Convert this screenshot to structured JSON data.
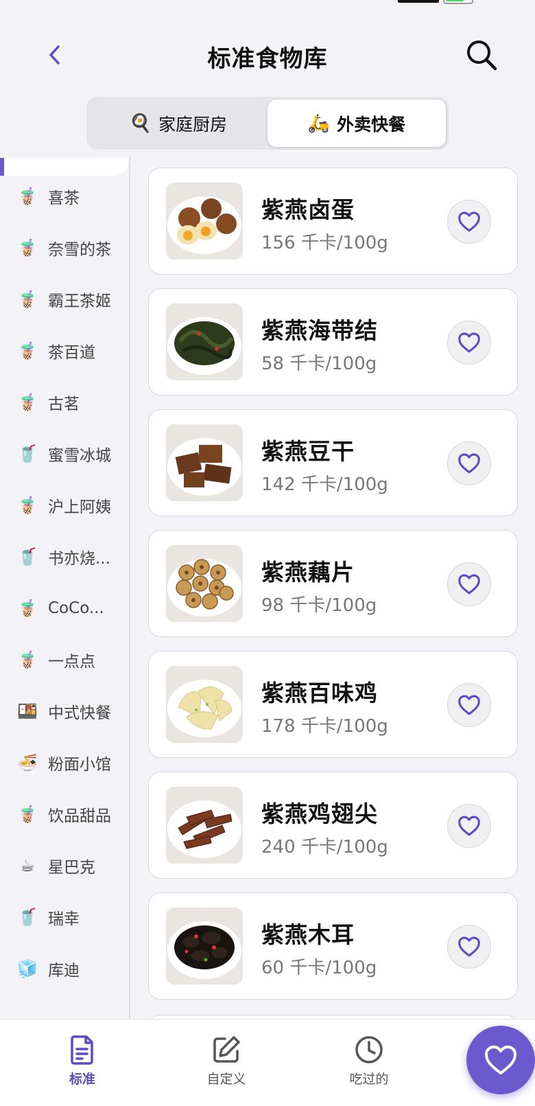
{
  "header": {
    "title": "标准食物库"
  },
  "segment": {
    "tabs": [
      {
        "icon": "🍳",
        "label": "家庭厨房",
        "active": false
      },
      {
        "icon": "🛵",
        "label": "外卖快餐",
        "active": true
      }
    ]
  },
  "sidebar": {
    "items": [
      {
        "icon": "bubble-tea-icon",
        "glyph": "🧋",
        "label": "喜茶"
      },
      {
        "icon": "bubble-tea-icon",
        "glyph": "🧋",
        "label": "奈雪的茶"
      },
      {
        "icon": "bubble-tea-icon",
        "glyph": "🧋",
        "label": "霸王茶姬"
      },
      {
        "icon": "bubble-tea-icon",
        "glyph": "🧋",
        "label": "茶百道"
      },
      {
        "icon": "bubble-tea-icon",
        "glyph": "🧋",
        "label": "古茗"
      },
      {
        "icon": "cup-straw-icon",
        "glyph": "🥤",
        "label": "蜜雪冰城"
      },
      {
        "icon": "bubble-tea-icon",
        "glyph": "🧋",
        "label": "沪上阿姨"
      },
      {
        "icon": "cup-straw-icon",
        "glyph": "🥤",
        "label": "书亦烧..."
      },
      {
        "icon": "bubble-tea-icon",
        "glyph": "🧋",
        "label": "CoCo..."
      },
      {
        "icon": "bubble-tea-icon",
        "glyph": "🧋",
        "label": "一点点"
      },
      {
        "icon": "bento-icon",
        "glyph": "🍱",
        "label": "中式快餐"
      },
      {
        "icon": "noodle-bowl-icon",
        "glyph": "🍜",
        "label": "粉面小馆"
      },
      {
        "icon": "bubble-tea-icon",
        "glyph": "🧋",
        "label": "饮品甜品"
      },
      {
        "icon": "coffee-icon",
        "glyph": "☕",
        "label": "星巴克"
      },
      {
        "icon": "cup-straw-icon",
        "glyph": "🥤",
        "label": "瑞幸"
      },
      {
        "icon": "ice-cube-icon",
        "glyph": "🧊",
        "label": "库迪"
      }
    ]
  },
  "foods": [
    {
      "name": "紫燕卤蛋",
      "kcal": "156 千卡/100g",
      "image": "braised-eggs"
    },
    {
      "name": "紫燕海带结",
      "kcal": "58 千卡/100g",
      "image": "kelp-knots"
    },
    {
      "name": "紫燕豆干",
      "kcal": "142 千卡/100g",
      "image": "dried-tofu"
    },
    {
      "name": "紫燕藕片",
      "kcal": "98 千卡/100g",
      "image": "lotus-root-slices"
    },
    {
      "name": "紫燕百味鸡",
      "kcal": "178 千卡/100g",
      "image": "sliced-chicken"
    },
    {
      "name": "紫燕鸡翅尖",
      "kcal": "240 千卡/100g",
      "image": "wing-tips"
    },
    {
      "name": "紫燕木耳",
      "kcal": "60 千卡/100g",
      "image": "wood-ear-fungus"
    }
  ],
  "tabbar": {
    "tabs": [
      {
        "label": "标准",
        "icon": "document-icon",
        "active": true
      },
      {
        "label": "自定义",
        "icon": "edit-icon",
        "active": false
      },
      {
        "label": "吃过的",
        "icon": "clock-icon",
        "active": false
      }
    ]
  },
  "colors": {
    "accent": "#6a5acd",
    "background": "#f2f2f7"
  }
}
